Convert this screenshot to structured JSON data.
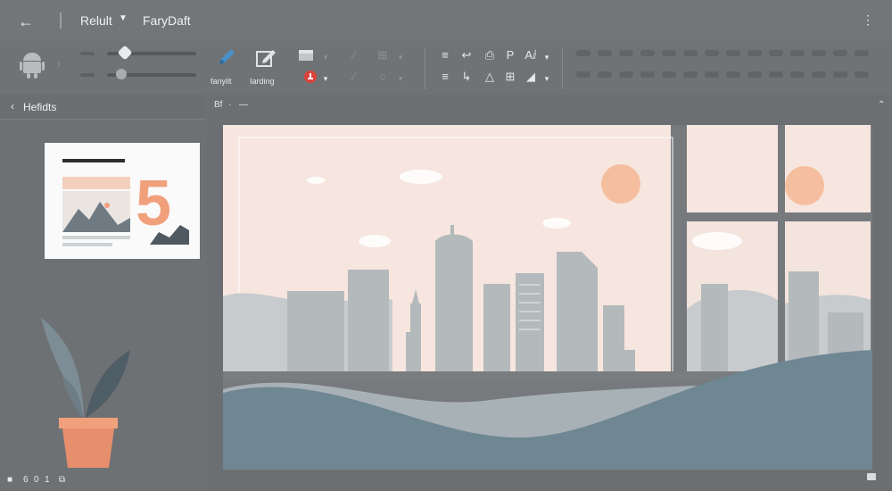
{
  "titlebar": {
    "back_icon": "arrow-left-icon",
    "file_menu": "Relult",
    "document_name": "FaryDaft",
    "more_icon": "vertical-dots-icon"
  },
  "toolbar": {
    "pen_label": "fanyilt",
    "shape_label": "Iarding"
  },
  "left_panel": {
    "title": "Hefidts",
    "slide_number": "5",
    "status_items": [
      "6",
      "0",
      "1"
    ]
  },
  "canvas": {
    "toolbar_items": [
      "Bf",
      "·",
      "—"
    ]
  },
  "colors": {
    "accent": "#f1a07c",
    "sky": "#f6e6df",
    "building": "#b3b8bb",
    "hill": "#6f8693"
  }
}
